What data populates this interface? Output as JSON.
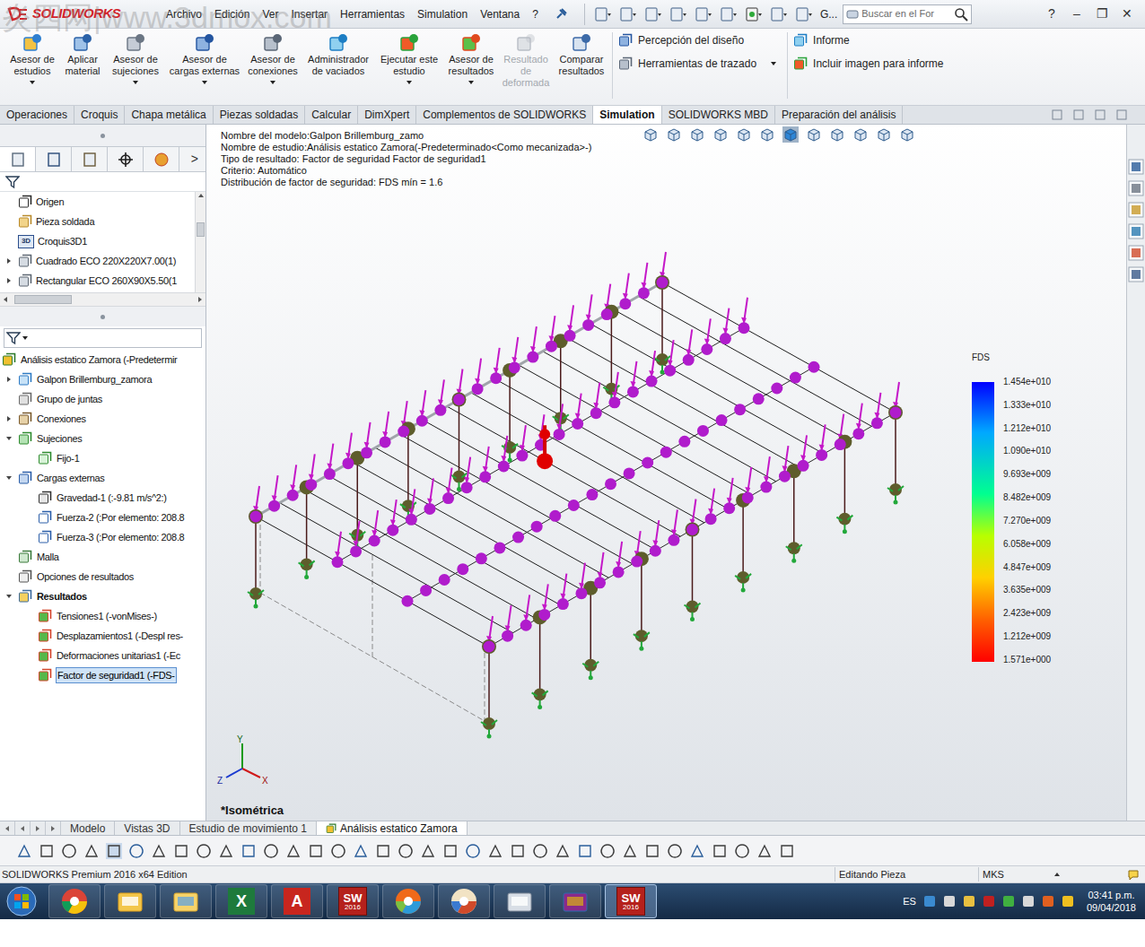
{
  "watermark": "炎四网|www.3dmox.com",
  "logo": {
    "text": "SOLIDWORKS"
  },
  "menu": [
    "Archivo",
    "Edición",
    "Ver",
    "Insertar",
    "Herramientas",
    "Simulation",
    "Ventana",
    "?"
  ],
  "quick_access": {
    "label": "G..."
  },
  "search": {
    "placeholder": "Buscar en el For"
  },
  "window_controls": [
    "?",
    "–",
    "❐",
    "✕"
  ],
  "ribbon": {
    "buttons": [
      {
        "lines": [
          "Asesor de",
          "estudios"
        ],
        "disabled": false,
        "dropdown": true
      },
      {
        "lines": [
          "Aplicar",
          "material"
        ],
        "disabled": false,
        "dropdown": false
      },
      {
        "lines": [
          "Asesor de",
          "sujeciones"
        ],
        "disabled": false,
        "dropdown": true
      },
      {
        "lines": [
          "Asesor de",
          "cargas externas"
        ],
        "disabled": false,
        "dropdown": true
      },
      {
        "lines": [
          "Asesor de",
          "conexiones"
        ],
        "disabled": false,
        "dropdown": true
      },
      {
        "lines": [
          "Administrador",
          "de vaciados"
        ],
        "disabled": false,
        "dropdown": false
      },
      {
        "lines": [
          "Ejecutar este",
          "estudio"
        ],
        "disabled": false,
        "dropdown": true
      },
      {
        "lines": [
          "Asesor de",
          "resultados"
        ],
        "disabled": false,
        "dropdown": true
      },
      {
        "lines": [
          "Resultado",
          "de",
          "deformada"
        ],
        "disabled": true,
        "dropdown": false
      },
      {
        "lines": [
          "Comparar",
          "resultados"
        ],
        "disabled": false,
        "dropdown": false
      }
    ],
    "groups": [
      [
        {
          "label": "Percepción del diseño",
          "dropdown": false
        },
        {
          "label": "Herramientas de trazado",
          "dropdown": true
        }
      ],
      [
        {
          "label": "Informe",
          "dropdown": false
        },
        {
          "label": "Incluir imagen para informe",
          "dropdown": false
        }
      ]
    ]
  },
  "command_tabs": [
    {
      "label": "Operaciones",
      "selected": false
    },
    {
      "label": "Croquis",
      "selected": false
    },
    {
      "label": "Chapa metálica",
      "selected": false
    },
    {
      "label": "Piezas soldadas",
      "selected": false
    },
    {
      "label": "Calcular",
      "selected": false
    },
    {
      "label": "DimXpert",
      "selected": false
    },
    {
      "label": "Complementos de SOLIDWORKS",
      "selected": false
    },
    {
      "label": "Simulation",
      "selected": true
    },
    {
      "label": "SOLIDWORKS MBD",
      "selected": false
    },
    {
      "label": "Preparación del análisis",
      "selected": false
    }
  ],
  "left_panel": {
    "more": ">",
    "feature_tree": [
      {
        "label": "Origen",
        "kind": "origin",
        "expandable": false,
        "expanded": false
      },
      {
        "label": "Pieza soldada",
        "kind": "weldment",
        "expandable": false,
        "expanded": false
      },
      {
        "label": "Croquis3D1",
        "kind": "sketch3d",
        "badge": "3D",
        "expandable": false,
        "expanded": false
      },
      {
        "label": "Cuadrado ECO 220X220X7.00(1)",
        "kind": "profile",
        "expandable": true,
        "expanded": false
      },
      {
        "label": "Rectangular ECO 260X90X5.50(1",
        "kind": "profile",
        "expandable": true,
        "expanded": false
      }
    ],
    "sim_tree": [
      {
        "label": "Análisis estatico Zamora (-Predetermir",
        "depth": 0,
        "kind": "study",
        "expandable": false,
        "expanded": false,
        "selected": false,
        "bold": false
      },
      {
        "label": "Galpon Brillemburg_zamora",
        "depth": 0,
        "kind": "part",
        "expandable": true,
        "expanded": false,
        "selected": false,
        "bold": false
      },
      {
        "label": "Grupo de juntas",
        "depth": 0,
        "kind": "joints",
        "expandable": false,
        "expanded": false,
        "selected": false,
        "bold": false
      },
      {
        "label": "Conexiones",
        "depth": 0,
        "kind": "connections",
        "expandable": true,
        "expanded": false,
        "selected": false,
        "bold": false
      },
      {
        "label": "Sujeciones",
        "depth": 0,
        "kind": "fixtures",
        "expandable": true,
        "expanded": true,
        "selected": false,
        "bold": false
      },
      {
        "label": "Fijo-1",
        "depth": 1,
        "kind": "fixed",
        "expandable": false,
        "expanded": false,
        "selected": false,
        "bold": false
      },
      {
        "label": "Cargas externas",
        "depth": 0,
        "kind": "loads",
        "expandable": true,
        "expanded": true,
        "selected": false,
        "bold": false
      },
      {
        "label": "Gravedad-1 (:-9.81 m/s^2:)",
        "depth": 1,
        "kind": "gravity",
        "expandable": false,
        "expanded": false,
        "selected": false,
        "bold": false
      },
      {
        "label": "Fuerza-2 (:Por elemento: 208.8",
        "depth": 1,
        "kind": "force",
        "expandable": false,
        "expanded": false,
        "selected": false,
        "bold": false
      },
      {
        "label": "Fuerza-3 (:Por elemento: 208.8",
        "depth": 1,
        "kind": "force",
        "expandable": false,
        "expanded": false,
        "selected": false,
        "bold": false
      },
      {
        "label": "Malla",
        "depth": 0,
        "kind": "mesh",
        "expandable": false,
        "expanded": false,
        "selected": false,
        "bold": false
      },
      {
        "label": "Opciones de resultados",
        "depth": 0,
        "kind": "options",
        "expandable": false,
        "expanded": false,
        "selected": false,
        "bold": false
      },
      {
        "label": "Resultados",
        "depth": 0,
        "kind": "results",
        "expandable": true,
        "expanded": true,
        "selected": false,
        "bold": true
      },
      {
        "label": "Tensiones1 (-vonMises-)",
        "depth": 1,
        "kind": "plot",
        "expandable": false,
        "expanded": false,
        "selected": false,
        "bold": false
      },
      {
        "label": "Desplazamientos1 (-Despl res-",
        "depth": 1,
        "kind": "plot",
        "expandable": false,
        "expanded": false,
        "selected": false,
        "bold": false
      },
      {
        "label": "Deformaciones unitarias1 (-Ec",
        "depth": 1,
        "kind": "plot",
        "expandable": false,
        "expanded": false,
        "selected": false,
        "bold": false
      },
      {
        "label": "Factor de seguridad1 (-FDS-",
        "depth": 1,
        "kind": "plot",
        "expandable": false,
        "expanded": false,
        "selected": true,
        "bold": false
      }
    ]
  },
  "graphics": {
    "header": [
      "Nombre del modelo:Galpon Brillemburg_zamo",
      "Nombre de estudio:Análisis estatico Zamora(-Predeterminado<Como mecanizada>-)",
      "Tipo de resultado: Factor de seguridad Factor de seguridad1",
      "Criterio: Automático",
      "Distribución de factor de seguridad: FDS mín = 1.6"
    ],
    "legend": {
      "title": "FDS",
      "values": [
        "1.454e+010",
        "1.333e+010",
        "1.212e+010",
        "1.090e+010",
        "9.693e+009",
        "8.482e+009",
        "7.270e+009",
        "6.058e+009",
        "4.847e+009",
        "3.635e+009",
        "2.423e+009",
        "1.212e+009",
        "1.571e+000"
      ]
    },
    "view_label": "*Isométrica",
    "triad": [
      "Y",
      "X",
      "Z"
    ]
  },
  "bottom_tabs": [
    {
      "label": "Modelo",
      "selected": false
    },
    {
      "label": "Vistas 3D",
      "selected": false
    },
    {
      "label": "Estudio de movimiento 1",
      "selected": false
    },
    {
      "label": "Análisis estatico Zamora",
      "selected": true
    }
  ],
  "status_bar": {
    "edition": "SOLIDWORKS Premium 2016 x64 Edition",
    "mode": "Editando Pieza",
    "units": "MKS"
  },
  "taskbar": {
    "apps": [
      {
        "kind": "chrome",
        "selected": false
      },
      {
        "kind": "mail",
        "selected": false
      },
      {
        "kind": "explorer",
        "selected": false
      },
      {
        "kind": "excel",
        "mark": "X",
        "selected": false
      },
      {
        "kind": "autocad",
        "mark": "A",
        "selected": false
      },
      {
        "kind": "solidworks",
        "mark": "SW",
        "label": "2016",
        "selected": false
      },
      {
        "kind": "media",
        "selected": false
      },
      {
        "kind": "paint",
        "selected": false
      },
      {
        "kind": "calculator",
        "selected": false
      },
      {
        "kind": "winrar",
        "selected": false
      },
      {
        "kind": "solidworks",
        "mark": "SW",
        "label": "2016",
        "selected": true
      }
    ],
    "language": "ES",
    "time": "03:41 p.m.",
    "date": "09/04/2018"
  }
}
